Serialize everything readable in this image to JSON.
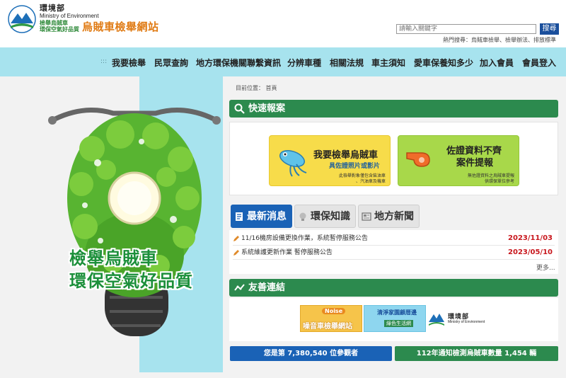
{
  "header": {
    "agency_cn": "環境部",
    "agency_en": "Ministry of Environment",
    "agency_tagline_1": "檢舉烏賊車",
    "agency_tagline_2": "環保空氣好品質",
    "site_title": "烏賊車檢舉網站",
    "search_placeholder": "請輸入關鍵字",
    "search_button": "搜尋",
    "hot_search": "熱門搜尋：烏賊車檢舉、檢舉辦法、排放標準"
  },
  "nav": {
    "items": [
      "我要檢舉",
      "民眾查詢",
      "地方環保機關聯繫資訊",
      "分辨車種",
      "相關法規",
      "車主須知",
      "愛車保養知多少",
      "加入會員",
      "會員登入"
    ]
  },
  "hero": {
    "slogan_1": "檢舉烏賊車",
    "slogan_2": "環保空氣好品質"
  },
  "breadcrumb": "目前位置： 首頁",
  "quick_report": {
    "title": "快速報案",
    "card1": {
      "title": "我要檢舉烏賊車",
      "subtitle": "具佐證照片或影片",
      "note_1": "此檢舉對象僅包含柴油車",
      "note_2": "、汽油車及機車"
    },
    "card2": {
      "title_1": "佐證資料不齊",
      "title_2": "案件提報",
      "note_1": "無佐證資料之烏賊車提報",
      "note_2": "供環保單位參考"
    }
  },
  "tabs": [
    "最新消息",
    "環保知識",
    "地方新聞"
  ],
  "news": [
    {
      "title": "11/16機房設備更換作業，系統暫停服務公告",
      "date": "2023/11/03"
    },
    {
      "title": "系統維護更新作業 暫停服務公告",
      "date": "2023/05/10"
    }
  ],
  "more_label": "更多...",
  "friendly_links": {
    "title": "友善連結",
    "banner_noise_tag": "Noise",
    "banner_noise_label": "噪音車檢舉網站",
    "banner_clean_label_1": "清淨家園顧厝邊",
    "banner_clean_label_2": "綠色生活網",
    "banner_epa_cn": "環境部",
    "banner_epa_en": "Ministry of Environment"
  },
  "counters": {
    "visitors": "您是第 7,380,540 位參觀者",
    "reports": "112年通知檢測烏賊車數量 1,454 輛"
  },
  "colors": {
    "nav_bg": "#a7e3ee",
    "green": "#2c8a4e",
    "blue": "#1a62b6",
    "orange": "#e07b14",
    "red": "#c8171d"
  }
}
